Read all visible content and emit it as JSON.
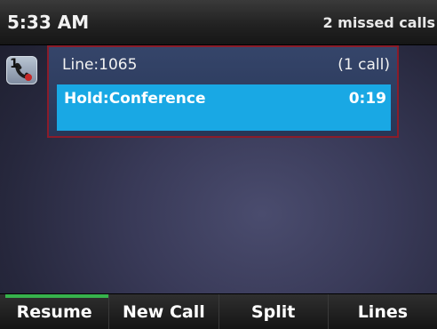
{
  "status_bar": {
    "time": "5:33 AM",
    "missed_calls": "2 missed calls"
  },
  "line_key": {
    "number": "1",
    "icon": "phone-handset-icon"
  },
  "call_panel": {
    "line_label": "Line:1065",
    "call_count": "(1 call)",
    "call": {
      "state": "Hold:Conference",
      "timer": "0:19"
    }
  },
  "softkeys": [
    {
      "label": "Resume",
      "selected": true
    },
    {
      "label": "New Call",
      "selected": false
    },
    {
      "label": "Split",
      "selected": false
    },
    {
      "label": "Lines",
      "selected": false
    }
  ],
  "colors": {
    "selected_call": "#19a8e4",
    "panel_border": "#8a1c2a",
    "softkey_indicator": "#37b24d"
  }
}
